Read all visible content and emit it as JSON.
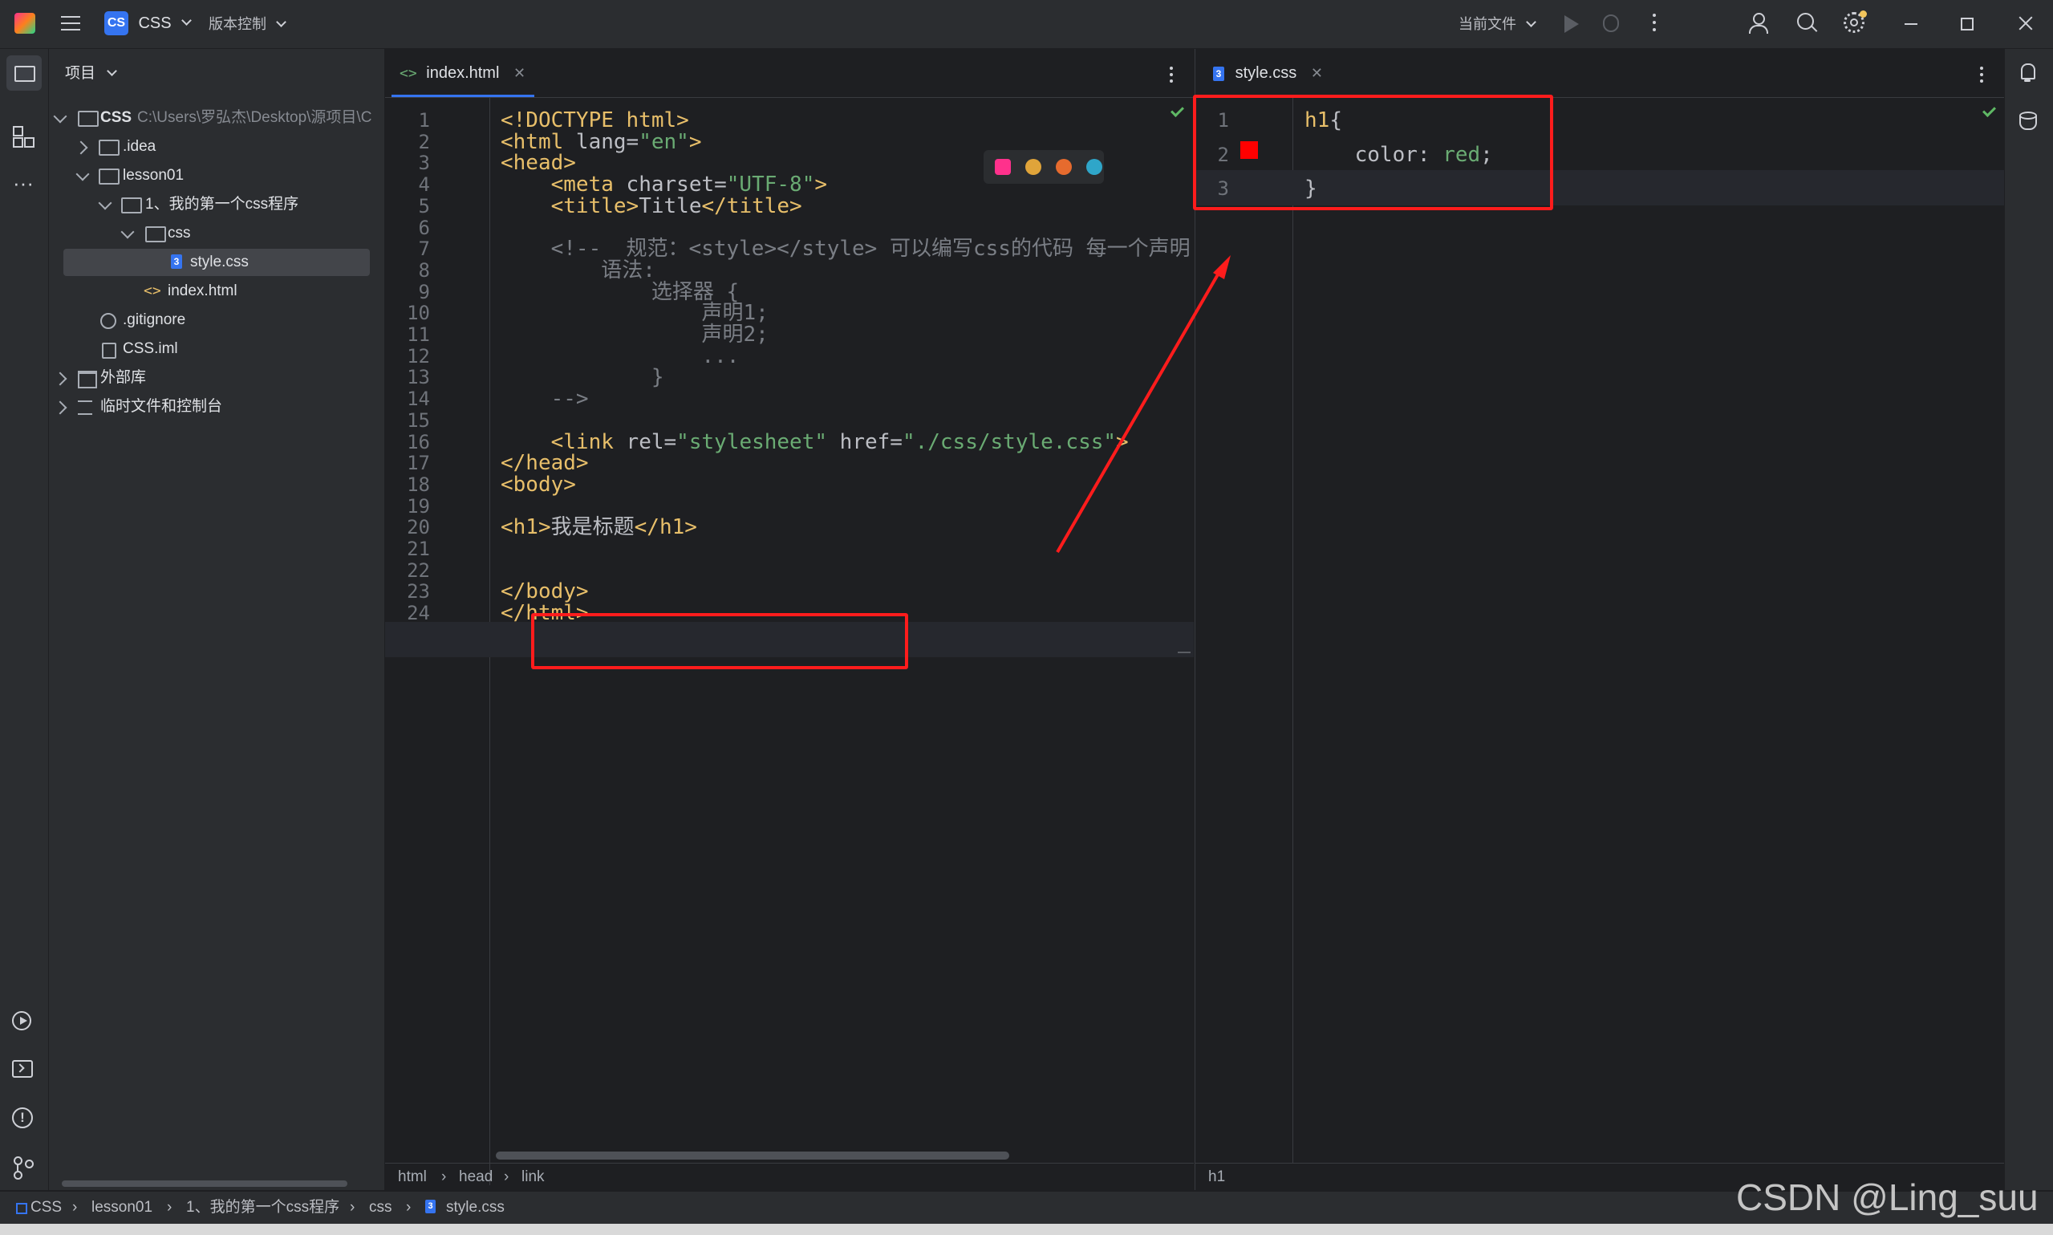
{
  "topbar": {
    "project_badge": "CS",
    "project_name": "CSS",
    "vcs_menu": "版本控制",
    "run_config": "当前文件"
  },
  "project_panel": {
    "title": "项目",
    "tree": [
      {
        "label": "CSS",
        "path": "C:\\Users\\罗弘杰\\Desktop\\源项目\\C"
      },
      {
        "label": ".idea"
      },
      {
        "label": "lesson01"
      },
      {
        "label": "1、我的第一个css程序"
      },
      {
        "label": "css"
      },
      {
        "label": "style.css"
      },
      {
        "label": "index.html"
      },
      {
        "label": ".gitignore"
      },
      {
        "label": "CSS.iml"
      },
      {
        "label": "外部库"
      },
      {
        "label": "临时文件和控制台"
      }
    ]
  },
  "editor_left": {
    "tab_label": "index.html",
    "breadcrumb": [
      "html",
      "head",
      "link"
    ],
    "line_numbers": [
      "1",
      "2",
      "3",
      "4",
      "5",
      "6",
      "7",
      "8",
      "9",
      "10",
      "11",
      "12",
      "13",
      "14",
      "15",
      "16",
      "17",
      "18",
      "19",
      "20",
      "21",
      "22",
      "23",
      "24"
    ],
    "lines": [
      [
        [
          "tag",
          "<!DOCTYPE html>"
        ]
      ],
      [
        [
          "tag",
          "<html "
        ],
        [
          "attr",
          "lang="
        ],
        [
          "str",
          "\"en\""
        ],
        [
          "tag",
          ">"
        ]
      ],
      [
        [
          "tag",
          "<head>"
        ]
      ],
      [
        [
          "txt",
          "    "
        ],
        [
          "tag",
          "<meta "
        ],
        [
          "attr",
          "charset="
        ],
        [
          "str",
          "\"UTF-8\""
        ],
        [
          "tag",
          ">"
        ]
      ],
      [
        [
          "txt",
          "    "
        ],
        [
          "tag",
          "<title>"
        ],
        [
          "txt",
          "Title"
        ],
        [
          "tag",
          "</title>"
        ]
      ],
      [],
      [
        [
          "cmt",
          "    <!--  规范：<style></style> 可以编写css的代码 每一个声明"
        ]
      ],
      [
        [
          "cmt",
          "        语法:"
        ]
      ],
      [
        [
          "cmt",
          "            选择器 {"
        ]
      ],
      [
        [
          "cmt",
          "                声明1;"
        ]
      ],
      [
        [
          "cmt",
          "                声明2;"
        ]
      ],
      [
        [
          "cmt",
          "                ..."
        ]
      ],
      [
        [
          "cmt",
          "            }"
        ]
      ],
      [
        [
          "cmt",
          "    -->"
        ]
      ],
      [],
      [
        [
          "txt",
          "    "
        ],
        [
          "tag",
          "<link "
        ],
        [
          "attr",
          "rel="
        ],
        [
          "str",
          "\"stylesheet\""
        ],
        [
          "attr",
          " href="
        ],
        [
          "str",
          "\"./css/style.css\""
        ],
        [
          "tag",
          ">"
        ]
      ],
      [
        [
          "tag",
          "</head>"
        ]
      ],
      [
        [
          "tag",
          "<body>"
        ]
      ],
      [],
      [
        [
          "tag",
          "<h1>"
        ],
        [
          "txt",
          "我是标题"
        ],
        [
          "tag",
          "</h1>"
        ]
      ],
      [],
      [],
      [
        [
          "tag",
          "</body>"
        ]
      ],
      [
        [
          "tag",
          "</html>"
        ]
      ]
    ]
  },
  "editor_right": {
    "tab_label": "style.css",
    "breadcrumb": [
      "h1"
    ],
    "line_numbers": [
      "1",
      "2",
      "3"
    ],
    "lines": [
      [
        [
          "sel",
          "h1"
        ],
        [
          "txt",
          "{"
        ]
      ],
      [
        [
          "txt",
          "    "
        ],
        [
          "prop",
          "color: "
        ],
        [
          "val",
          "red"
        ],
        [
          "txt",
          ";"
        ]
      ],
      [
        [
          "txt",
          "}"
        ]
      ]
    ]
  },
  "statusbar": {
    "path": [
      "CSS",
      "lesson01",
      "1、我的第一个css程序",
      "css",
      "style.css"
    ]
  },
  "watermark": "CSDN @Ling_suu",
  "colors": {
    "annotation_red": "#ff1c1c",
    "accent_blue": "#3574f0",
    "color_swatch": "#ff0000"
  }
}
